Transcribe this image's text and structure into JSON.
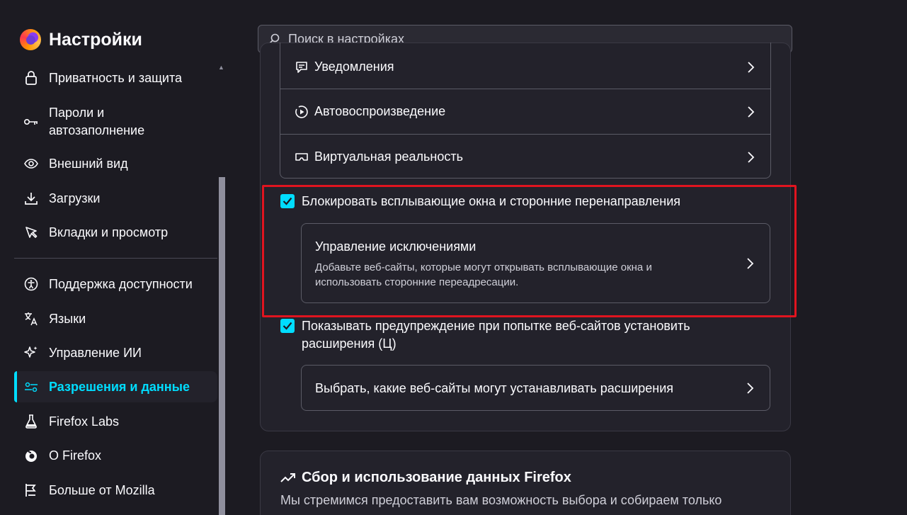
{
  "brand": {
    "title": "Настройки",
    "logo": "firefox-logo"
  },
  "sidebar": {
    "items": [
      {
        "label": "Приватность и защита",
        "icon": "lock-icon"
      },
      {
        "label": "Пароли и автозаполнение",
        "icon": "key-icon"
      },
      {
        "label": "Внешний вид",
        "icon": "eye-icon"
      },
      {
        "label": "Загрузки",
        "icon": "download-icon"
      },
      {
        "label": "Вкладки и просмотр",
        "icon": "pointer-icon"
      },
      {
        "label": "Поддержка доступности",
        "icon": "accessibility-icon"
      },
      {
        "label": "Языки",
        "icon": "translate-icon"
      },
      {
        "label": "Управление ИИ",
        "icon": "sparkle-icon"
      },
      {
        "label": "Разрешения и данные",
        "icon": "sliders-icon",
        "active": true
      },
      {
        "label": "Firefox Labs",
        "icon": "flask-icon"
      },
      {
        "label": "О Firefox",
        "icon": "firefox-icon"
      },
      {
        "label": "Больше от Mozilla",
        "icon": "mozilla-icon"
      }
    ]
  },
  "search": {
    "placeholder": "Поиск в настройках"
  },
  "permissions": {
    "rows": [
      {
        "label": "Уведомления",
        "icon": "notification-icon"
      },
      {
        "label": "Автовоспроизведение",
        "icon": "autoplay-icon"
      },
      {
        "label": "Виртуальная реальность",
        "icon": "vr-icon"
      }
    ]
  },
  "popups": {
    "checkbox_label": "Блокировать всплывающие окна и сторонние перенаправления",
    "checked": true,
    "card_title": "Управление исключениями",
    "card_desc": "Добавьте веб-сайты, которые могут открывать всплывающие окна и использовать сторонние переадресации."
  },
  "addons": {
    "checkbox_label": "Показывать предупреждение при попытке веб-сайтов установить расширения (Ц)",
    "checked": true,
    "card_title": "Выбрать, какие веб-сайты могут устанавливать расширения"
  },
  "data_collection": {
    "title": "Сбор и использование данных Firefox",
    "desc": "Мы стремимся предоставить вам возможность выбора и собираем только"
  },
  "colors": {
    "accent": "#00ddff",
    "highlight": "#e0141f",
    "background": "#1c1b22"
  }
}
